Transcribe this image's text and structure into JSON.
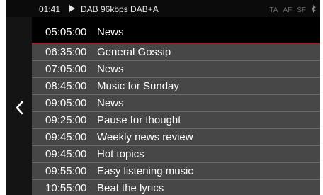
{
  "status": {
    "time": "01:41",
    "source": "DAB 96kbps DAB+A",
    "flags": [
      "TA",
      "AF",
      "SF"
    ]
  },
  "icons": {
    "play": "play-icon",
    "bluetooth": "bluetooth-icon",
    "back": "chevron-left-icon"
  },
  "current": {
    "time": "05:05:00",
    "title": "News"
  },
  "schedule": [
    {
      "time": "06:35:00",
      "title": "General Gossip"
    },
    {
      "time": "07:05:00",
      "title": "News"
    },
    {
      "time": "08:45:00",
      "title": "Music for Sunday"
    },
    {
      "time": "09:05:00",
      "title": "News"
    },
    {
      "time": "09:25:00",
      "title": "Pause for thought"
    },
    {
      "time": "09:45:00",
      "title": "Weekly news review"
    },
    {
      "time": "09:45:00",
      "title": "Hot topics"
    },
    {
      "time": "09:55:00",
      "title": "Easy listening music"
    },
    {
      "time": "10:55:00",
      "title": "Beat the lyrics"
    }
  ],
  "colors": {
    "accent": "#9d1a20",
    "row_bg": "#474747",
    "background": "#000000"
  }
}
